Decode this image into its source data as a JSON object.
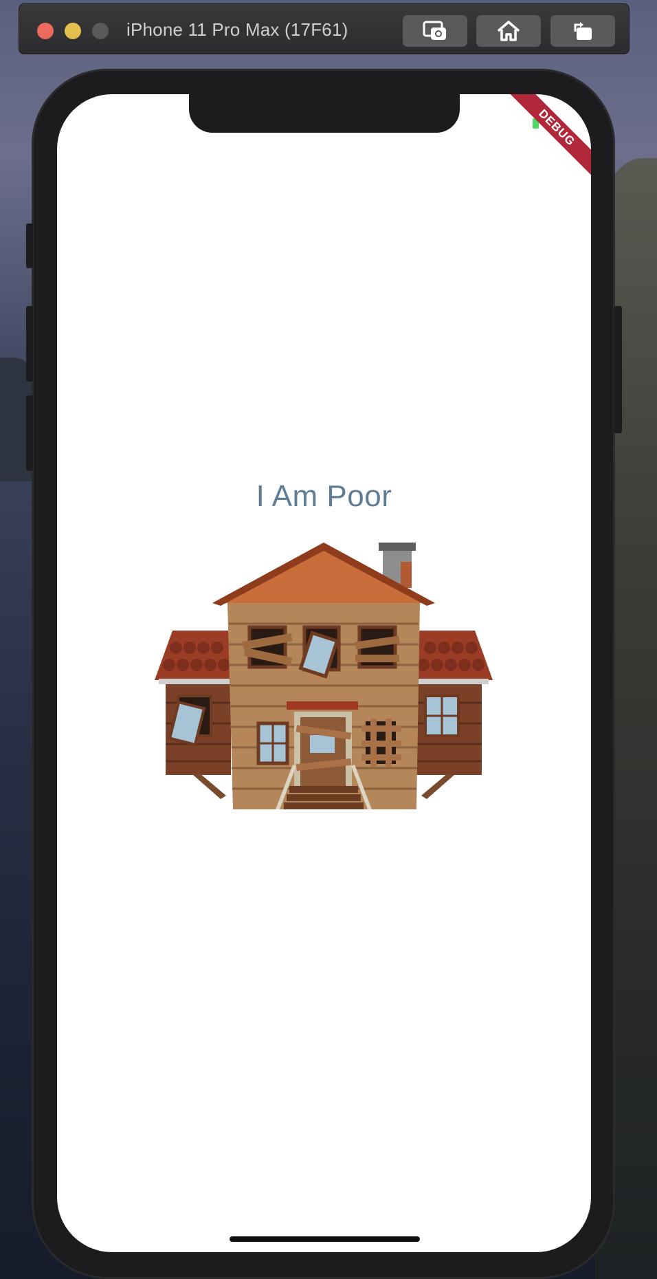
{
  "window": {
    "title": "iPhone 11 Pro Max (17F61)",
    "controls": [
      "close",
      "minimize",
      "zoom"
    ],
    "toolbar_buttons": [
      "screenshot-icon",
      "home-icon",
      "rotate-icon"
    ]
  },
  "device": {
    "debug_banner": "DEBUG"
  },
  "app": {
    "title": "I Am Poor",
    "image": "poor-house-illustration"
  },
  "colors": {
    "title_text": "#5f7d95",
    "debug_banner": "#b0283a",
    "screen_background": "#ffffff"
  }
}
